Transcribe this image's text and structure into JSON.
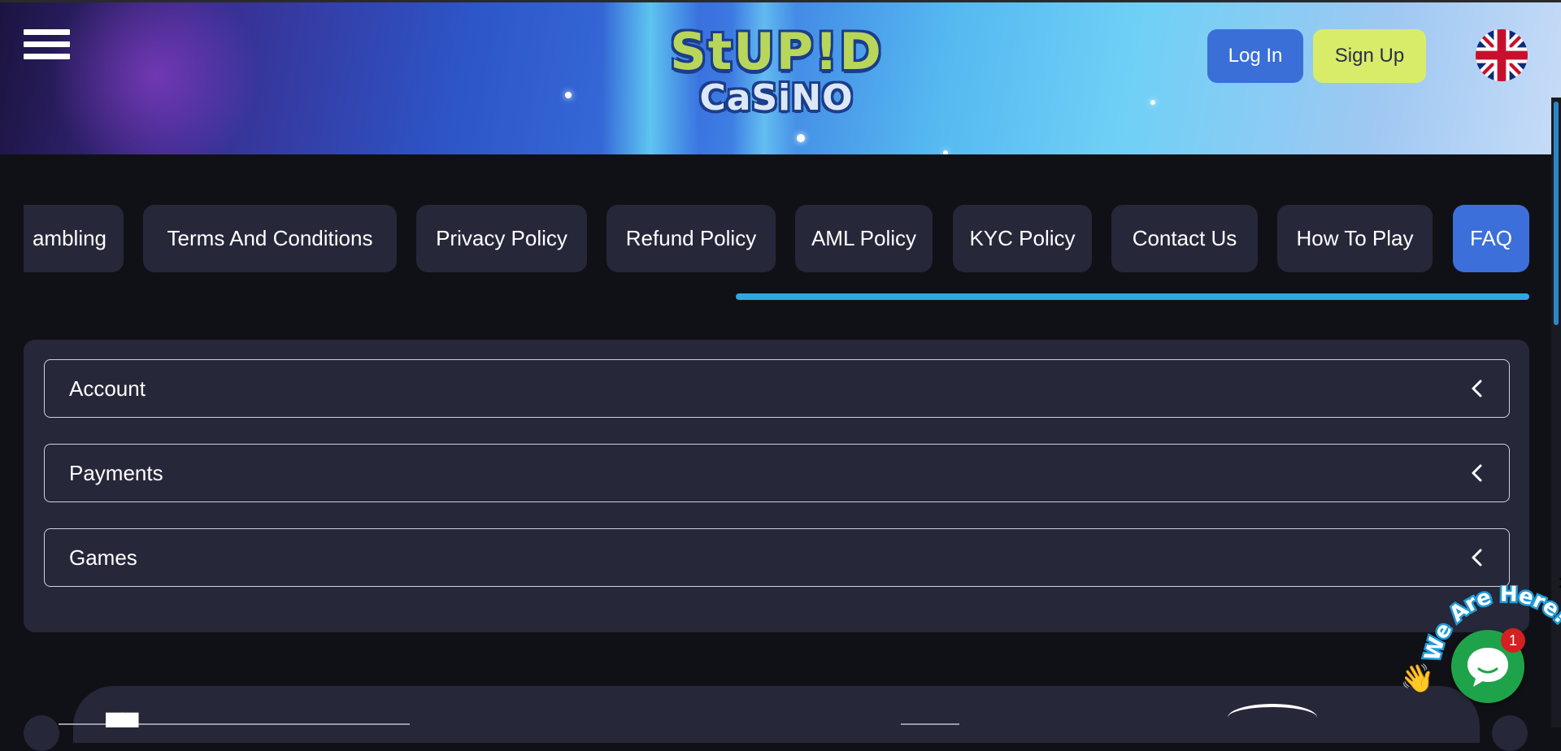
{
  "header": {
    "menu_icon": "hamburger-menu-icon",
    "logo": {
      "line1": "StUP!D",
      "line2": "CaSiNO"
    },
    "login_label": "Log In",
    "signup_label": "Sign Up",
    "language_icon": "uk-flag-icon"
  },
  "tabs": [
    {
      "label": "ambling"
    },
    {
      "label": "Terms And Conditions"
    },
    {
      "label": "Privacy Policy"
    },
    {
      "label": "Refund Policy"
    },
    {
      "label": "AML Policy"
    },
    {
      "label": "KYC Policy"
    },
    {
      "label": "Contact Us"
    },
    {
      "label": "How To Play"
    },
    {
      "label": "FAQ",
      "active": true
    }
  ],
  "faq": {
    "items": [
      {
        "label": "Account",
        "icon": "chevron-left-icon"
      },
      {
        "label": "Payments",
        "icon": "chevron-left-icon"
      },
      {
        "label": "Games",
        "icon": "chevron-left-icon"
      }
    ]
  },
  "chat": {
    "banner_text": "We Are Here!",
    "badge_count": "1",
    "close_label": "✕"
  },
  "colors": {
    "page_bg": "#101116",
    "card_bg": "#262739",
    "active_tab": "#3d6fda",
    "login": "#3a6fd8",
    "signup": "#d9ec6a",
    "progress": "#2ea8e3",
    "chat": "#1fa34a"
  }
}
